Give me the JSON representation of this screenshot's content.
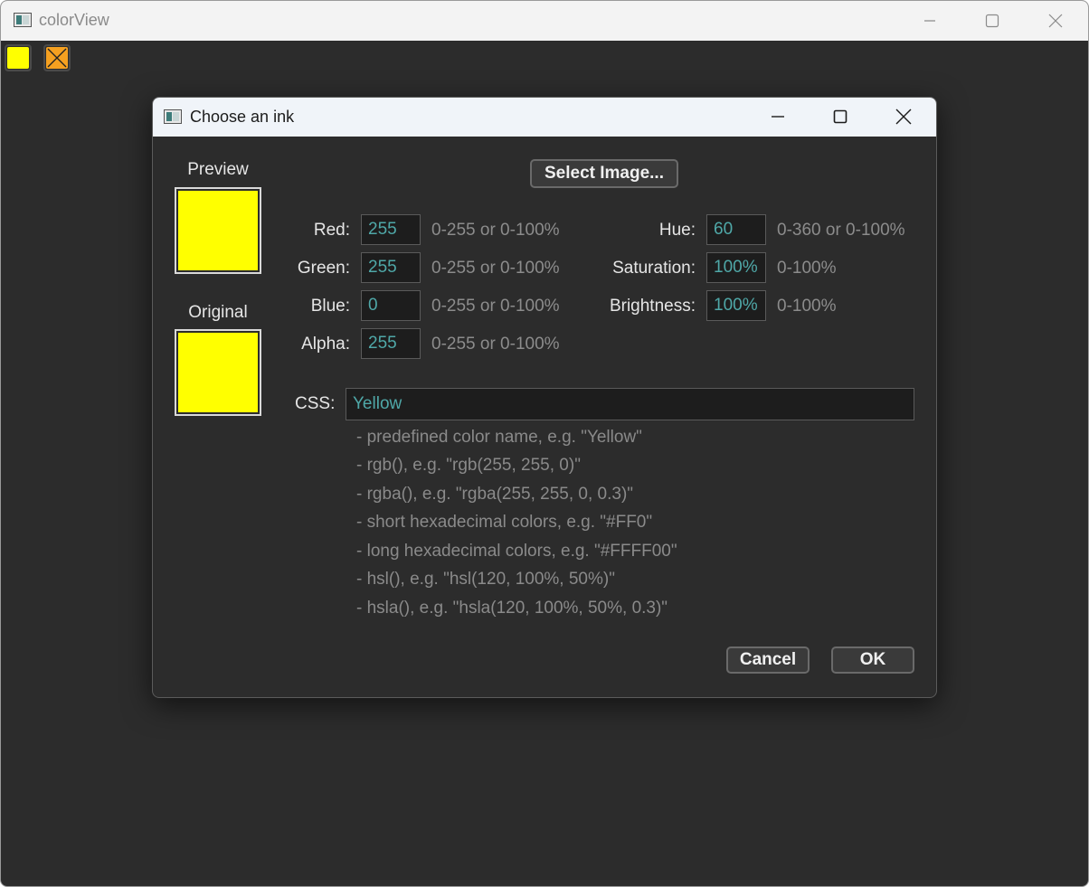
{
  "main_window": {
    "title": "colorView",
    "icon": "app-window-icon",
    "toolbar": {
      "swatches": [
        {
          "name": "current-ink-swatch",
          "color": "#ffff00"
        },
        {
          "name": "no-ink-swatch",
          "color": "#f5a020"
        }
      ]
    }
  },
  "dialog": {
    "title": "Choose an ink",
    "preview_label": "Preview",
    "original_label": "Original",
    "preview_color": "#ffff00",
    "original_color": "#ffff00",
    "select_image_label": "Select Image...",
    "rgba": {
      "red": {
        "label": "Red:",
        "value": "255",
        "hint": "0-255 or 0-100%"
      },
      "green": {
        "label": "Green:",
        "value": "255",
        "hint": "0-255 or 0-100%"
      },
      "blue": {
        "label": "Blue:",
        "value": "0",
        "hint": "0-255 or 0-100%"
      },
      "alpha": {
        "label": "Alpha:",
        "value": "255",
        "hint": "0-255 or 0-100%"
      }
    },
    "hsb": {
      "hue": {
        "label": "Hue:",
        "value": "60",
        "hint": "0-360 or 0-100%"
      },
      "saturation": {
        "label": "Saturation:",
        "value": "100%",
        "hint": "0-100%"
      },
      "brightness": {
        "label": "Brightness:",
        "value": "100%",
        "hint": "0-100%"
      }
    },
    "css": {
      "label": "CSS:",
      "value": "Yellow",
      "help": [
        "- predefined color name, e.g. \"Yellow\"",
        "- rgb(), e.g. \"rgb(255, 255, 0)\"",
        "- rgba(), e.g. \"rgba(255, 255, 0, 0.3)\"",
        "- short hexadecimal colors, e.g. \"#FF0\"",
        "- long hexadecimal colors, e.g. \"#FFFF00\"",
        "- hsl(), e.g. \"hsl(120, 100%, 50%)\"",
        "- hsla(), e.g. \"hsla(120, 100%, 50%, 0.3)\""
      ]
    },
    "cancel_label": "Cancel",
    "ok_label": "OK"
  },
  "colors": {
    "accent_value_text": "#4fa8a8",
    "background": "#2c2c2c",
    "titlebar": "#f0f4f9"
  }
}
